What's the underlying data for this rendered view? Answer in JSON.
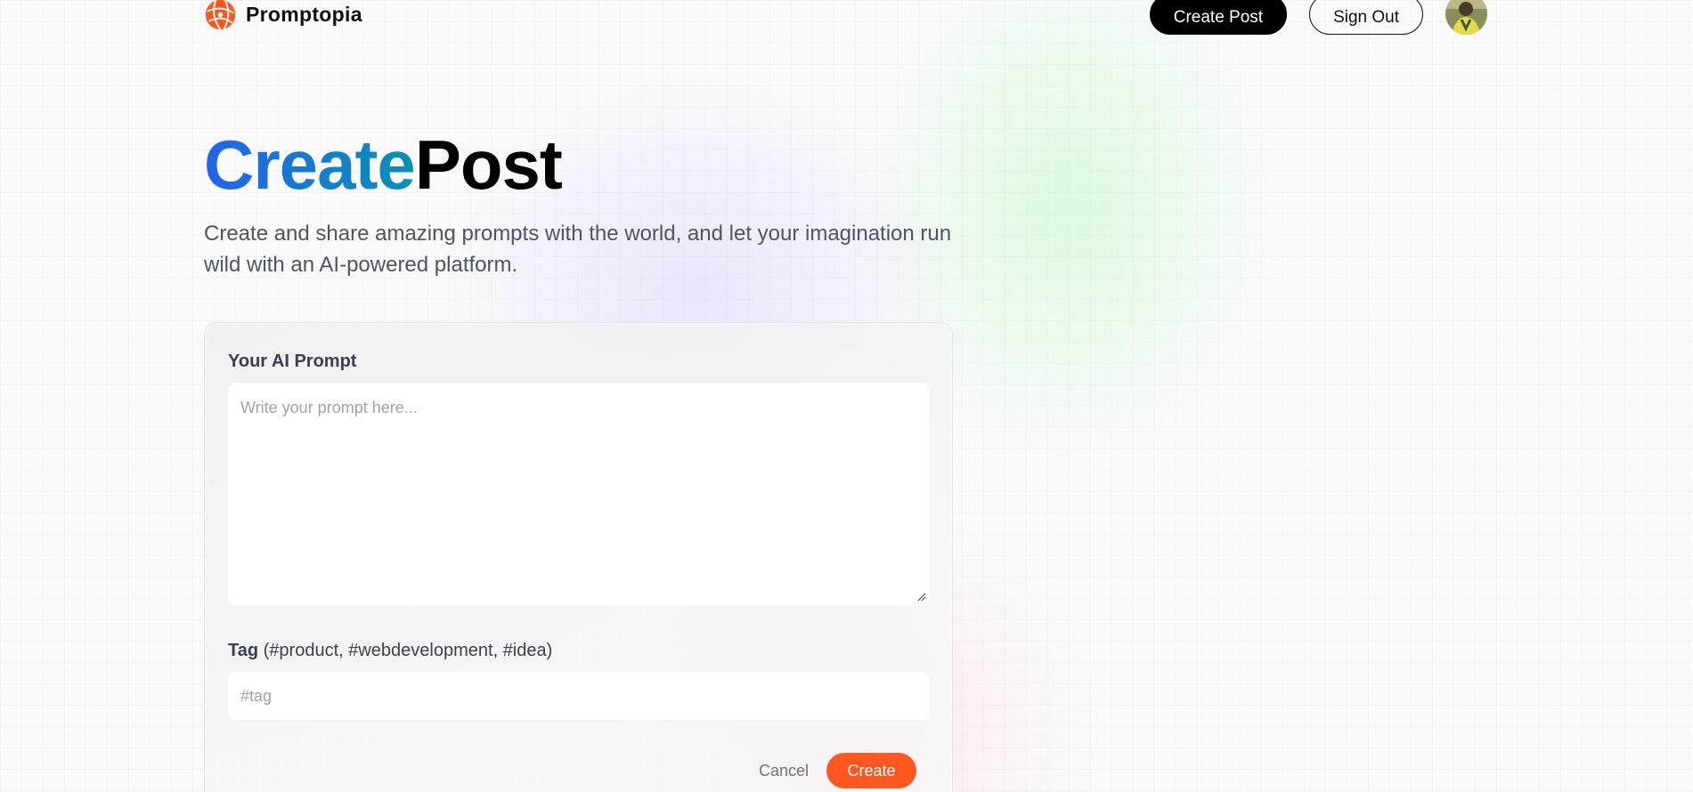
{
  "brand": {
    "name": "Promptopia",
    "logo_icon": "globe-logo-icon",
    "accent": "#ff5722"
  },
  "nav": {
    "create_post": "Create Post",
    "sign_out": "Sign Out",
    "avatar_icon": "user-avatar"
  },
  "hero": {
    "title_highlight": "Create",
    "title_rest": "Post",
    "description": "Create and share amazing prompts with the world, and let your imagination run wild with an AI-powered platform."
  },
  "form": {
    "prompt_label": "Your AI Prompt",
    "prompt_placeholder": "Write your prompt here...",
    "prompt_value": "",
    "tag_label_bold": "Tag",
    "tag_label_hint": " (#product, #webdevelopment, #idea)",
    "tag_placeholder": "#tag",
    "tag_value": "",
    "cancel_label": "Cancel",
    "submit_label": "Create"
  },
  "colors": {
    "primary_button": "#000000",
    "submit_button": "#ff5722",
    "gradient_start": "#2563eb",
    "gradient_end": "#0891b2"
  }
}
